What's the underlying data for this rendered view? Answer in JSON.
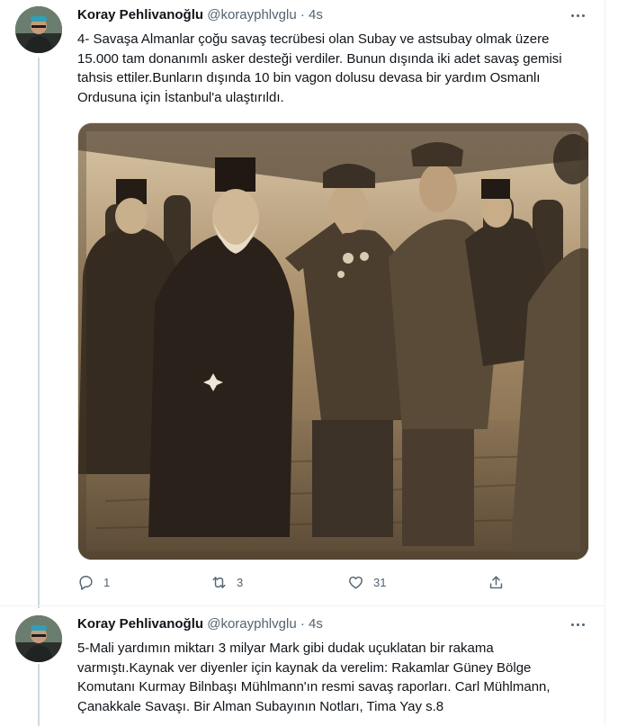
{
  "tweets": [
    {
      "author_name": "Koray Pehlivanoğlu",
      "handle": "@korayphlvglu",
      "separator": "·",
      "time": "4s",
      "text": "4- Savaşa Almanlar çoğu savaş tecrübesi olan Subay ve astsubay olmak üzere 15.000 tam donanımlı asker desteği verdiler. Bunun dışında iki adet savaş gemisi tahsis ettiler.Bunların dışında 10 bin vagon dolusu devasa bir yardım Osmanlı Ordusuna için İstanbul'a ulaştırıldı.",
      "actions": {
        "reply_count": "1",
        "retweet_count": "3",
        "like_count": "31"
      }
    },
    {
      "author_name": "Koray Pehlivanoğlu",
      "handle": "@korayphlvglu",
      "separator": "·",
      "time": "4s",
      "text": "5-Mali yardımın miktarı 3 milyar Mark gibi dudak uçuklatan bir rakama varmıştı.Kaynak ver diyenler için kaynak da verelim: Rakamlar Güney Bölge Komutanı Kurmay Bilnbaşı Mühlmann'ın resmi savaş raporları. Carl Mühlmann, Çanakkale Savaşı. Bir Alman Subayının Notları, Tima Yay s.8"
    }
  ],
  "colors": {
    "text_primary": "#0f1419",
    "text_secondary": "#536471",
    "thread_line": "#cfd9de",
    "divider": "#eff3f4",
    "photo_sepia": "#b39b78"
  },
  "icons": [
    "avatar",
    "more-icon",
    "reply-icon",
    "retweet-icon",
    "like-icon",
    "share-icon"
  ]
}
